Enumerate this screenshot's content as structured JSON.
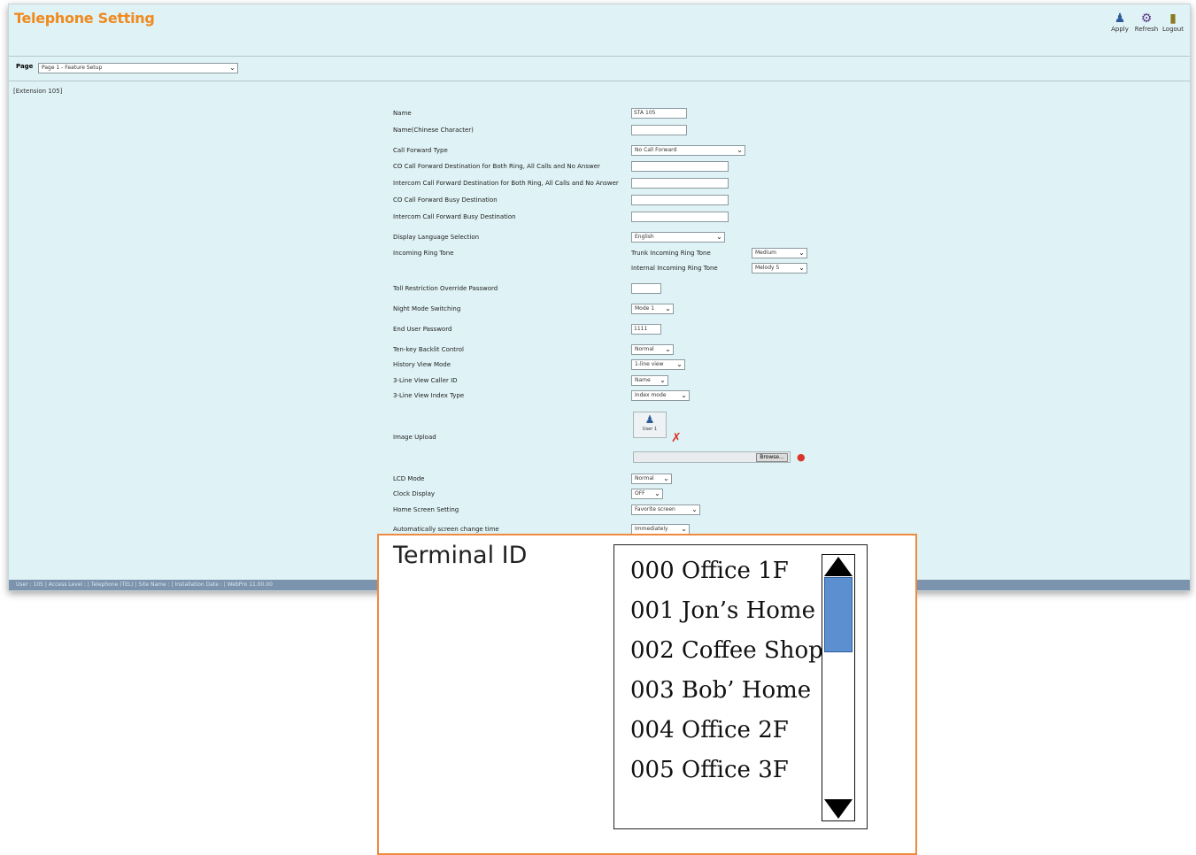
{
  "window": {
    "title": "Telephone Setting",
    "toolbar": [
      {
        "label": "Apply",
        "icon": "apply-icon"
      },
      {
        "label": "Refresh",
        "icon": "refresh-icon"
      },
      {
        "label": "Logout",
        "icon": "logout-icon"
      }
    ],
    "page_label": "Page",
    "page_value": "Page 1 - Feature Setup",
    "extension": "[Extension 105]",
    "status_bar": "User : 105 | Access Level : | Telephone (TEL) | Site Name : | Installation Date : | WebPro 11.00.00"
  },
  "fields": [
    {
      "label": "Name",
      "type": "input",
      "value": "STA 105"
    },
    {
      "label": "Name(Chinese Character)",
      "type": "input",
      "value": ""
    },
    {
      "label": "Call Forward Type",
      "type": "select",
      "value": "No Call Forward"
    },
    {
      "label": "CO Call Forward Destination for Both Ring, All Calls and No Answer",
      "type": "input",
      "value": ""
    },
    {
      "label": "Intercom Call Forward Destination for Both Ring, All Calls and No Answer",
      "type": "input",
      "value": ""
    },
    {
      "label": "CO Call Forward Busy Destination",
      "type": "input",
      "value": ""
    },
    {
      "label": "Intercom Call Forward Busy Destination",
      "type": "input",
      "value": ""
    },
    {
      "label": "Display Language Selection",
      "type": "select",
      "value": "English"
    },
    {
      "label": "Incoming Ring Tone",
      "type": "group"
    },
    {
      "label": "Toll Restriction Override Password",
      "type": "input",
      "value": ""
    },
    {
      "label": "Night Mode Switching",
      "type": "select",
      "value": "Mode 1"
    },
    {
      "label": "End User Password",
      "type": "input",
      "value": "1111"
    },
    {
      "label": "Ten-key Backlit Control",
      "type": "select",
      "value": "Normal"
    },
    {
      "label": "History View Mode",
      "type": "select",
      "value": "1-line view"
    },
    {
      "label": "3-Line View Caller ID",
      "type": "select",
      "value": "Name"
    },
    {
      "label": "3-Line View Index Type",
      "type": "select",
      "value": "Index mode"
    },
    {
      "label": "Image Upload",
      "type": "image"
    },
    {
      "label": "LCD Mode",
      "type": "select",
      "value": "Normal"
    },
    {
      "label": "Clock Display",
      "type": "select",
      "value": "OFF"
    },
    {
      "label": "Home Screen Setting",
      "type": "select",
      "value": "Favorite screen"
    },
    {
      "label": "Automatically screen change time",
      "type": "select",
      "value": "Immediately"
    }
  ],
  "ring_tone": {
    "trunk_label": "Trunk Incoming Ring Tone",
    "trunk_value": "Medium",
    "internal_label": "Internal Incoming Ring Tone",
    "internal_value": "Melody 5"
  },
  "image_upload": {
    "thumb_caption": "User 1",
    "browse_label": "Browse..."
  },
  "callout": {
    "title": "Terminal ID",
    "items": [
      "000 Office 1F",
      "001 Jon’s Home",
      "002 Coffee Shop",
      "003 Bob’ Home",
      "004 Office 2F",
      "005 Office 3F"
    ],
    "accent_color": "#ef8a3e"
  }
}
